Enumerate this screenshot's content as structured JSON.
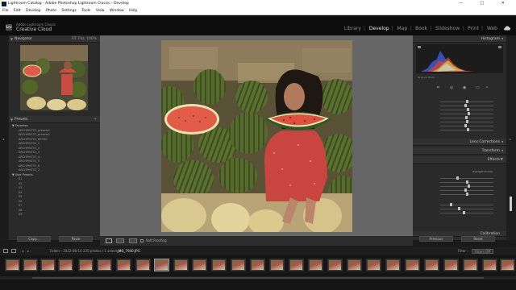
{
  "window": {
    "title": "Lightroom Catalog - Adobe Photoshop Lightroom Classic - Develop",
    "controls": [
      "—",
      "□",
      "✕"
    ]
  },
  "menu": [
    "File",
    "Edit",
    "Develop",
    "Photo",
    "Settings",
    "Tools",
    "View",
    "Window",
    "Help"
  ],
  "identity": {
    "logo": "Lrc",
    "line1": "Adobe Lightroom Classic",
    "line2": "Creative Cloud"
  },
  "modules": [
    {
      "label": "Library",
      "active": false
    },
    {
      "label": "Develop",
      "active": true
    },
    {
      "label": "Map",
      "active": false
    },
    {
      "label": "Book",
      "active": false
    },
    {
      "label": "Slideshow",
      "active": false
    },
    {
      "label": "Print",
      "active": false
    },
    {
      "label": "Web",
      "active": false
    }
  ],
  "left_panel": {
    "navigator_title": "Navigator",
    "navigator_zoom": [
      "FIT",
      "FILL",
      "100%"
    ],
    "presets_title": "Presets",
    "preset_groups": [
      {
        "name": "Favorites",
        "items": [
          "ARCHPHOTO_presets1",
          "ARCHPHOTO_presets2",
          "ARCHPHOTO_RETRO",
          "ARCHPHOTO_1",
          "ARCHPHOTO_2",
          "ARCHPHOTO_3",
          "ARCHPHOTO_4",
          "ARCHPHOTO_5",
          "ARCHPHOTO_6",
          "ARCHPHOTO_7"
        ]
      },
      {
        "name": "User Presets",
        "items": [
          "01",
          "02",
          "03",
          "04",
          "05",
          "06",
          "07",
          "08",
          "09"
        ]
      }
    ],
    "copy_button": "Copy...",
    "paste_button": "Paste"
  },
  "toolbar": {
    "soft_proofing": "Soft Proofing"
  },
  "right_panel": {
    "histogram_title": "Histogram",
    "original_photo": "Original Photo",
    "lens_corrections": "Lens Corrections",
    "transform": "Transform",
    "effects": "Effects",
    "calibration": "Calibration",
    "vignette_style": "Highlight Priority",
    "previous_button": "Previous",
    "reset_button": "Reset",
    "colors": {
      "shadow_blue": "#3a5ad0",
      "histo_red": "#d04040",
      "histo_yellow": "#d0c040"
    }
  },
  "filmstrip": {
    "path_text": "Folder : 2022-08-14",
    "count_text": "235 photos / 1 selected /",
    "filename": "_MG_7940.JPG",
    "filter_label": "Filter :",
    "filter_value": "Filters Off"
  }
}
